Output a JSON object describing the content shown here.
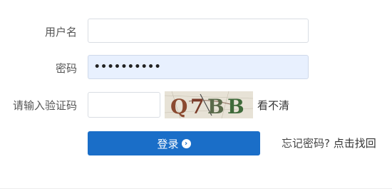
{
  "form": {
    "username_label": "用户名",
    "username_value": "",
    "password_label": "密码",
    "password_value": "••••••••••",
    "captcha_label": "请输入验证码",
    "captcha_value": "",
    "captcha_text": "Q7BB",
    "refresh_captcha": "看不清",
    "login_button": "登录",
    "login_icon": "arrow-circle-right-icon",
    "forgot_text": "忘记密码?",
    "forgot_link": "点击找回"
  },
  "colors": {
    "button": "#1a6ec8",
    "filled_input": "#e8f0fe"
  }
}
